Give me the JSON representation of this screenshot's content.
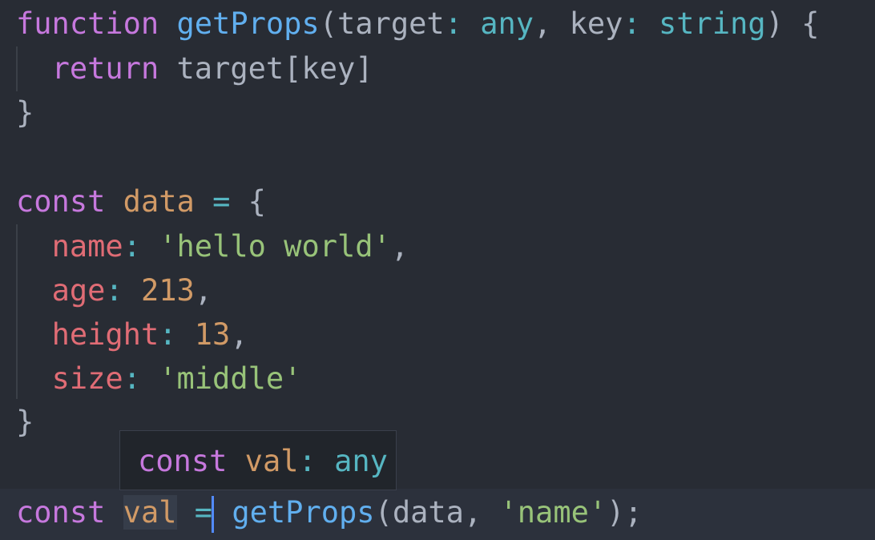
{
  "editor": {
    "theme_colors": {
      "background": "#282c34",
      "keyword": "#c678dd",
      "function": "#61afef",
      "type": "#56b6c2",
      "property": "#e06c75",
      "string": "#98c379",
      "number": "#d19a66",
      "cursor": "#528bff"
    },
    "lines": {
      "l1": {
        "kw": "function",
        "name": "getProps",
        "open": "(target",
        "colon1": ":",
        "type1": "any",
        "comma1": ", key",
        "colon2": ":",
        "type2": "string",
        "close": ") {"
      },
      "l2": {
        "kw": "return",
        "expr": "target[key]"
      },
      "l3": {
        "brace": "}"
      },
      "l5": {
        "kw": "const",
        "name": "data",
        "op": "=",
        "brace": "{"
      },
      "l6": {
        "prop": "name",
        "colon": ":",
        "value": "'hello world'",
        "comma": ","
      },
      "l7": {
        "prop": "age",
        "colon": ":",
        "value": "213",
        "comma": ","
      },
      "l8": {
        "prop": "height",
        "colon": ":",
        "value": "13",
        "comma": ","
      },
      "l9": {
        "prop": "size",
        "colon": ":",
        "value": "'middle'"
      },
      "l10": {
        "brace": "}"
      },
      "l12": {
        "kw": "const",
        "name": "val",
        "op": "=",
        "fn": "getProps",
        "args_open": "(data, ",
        "arg_str": "'name'",
        "args_close": ");"
      }
    },
    "hover": {
      "kw": "const",
      "name": "val",
      "colon": ":",
      "type": "any"
    }
  }
}
